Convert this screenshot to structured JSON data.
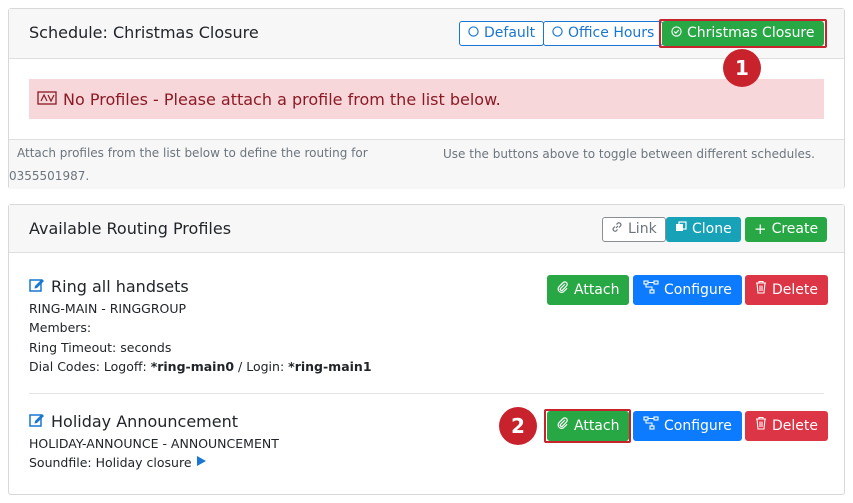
{
  "schedule": {
    "title": "Schedule: Christmas Closure",
    "buttons": {
      "default": "Default",
      "office_hours": "Office Hours",
      "christmas_closure": "Christmas Closure"
    },
    "alert": "No Profiles - Please attach a profile from the list below.",
    "footer_left_1": "Attach profiles from the list below to define the routing for",
    "footer_left_2": "0355501987.",
    "footer_right": "Use the buttons above to toggle between different schedules."
  },
  "routing": {
    "title": "Available Routing Profiles",
    "link_label": "Link",
    "clone_label": "Clone",
    "create_label": "Create",
    "profiles": [
      {
        "name": "Ring all handsets",
        "type_line": "RING-MAIN - RINGGROUP",
        "members": "Members:",
        "timeout": "Ring Timeout: seconds",
        "dial_prefix": "Dial Codes: Logoff:",
        "logoff_code": "*ring-main0",
        "login_sep": "/ Login:",
        "login_code": "*ring-main1"
      },
      {
        "name": "Holiday Announcement",
        "type_line": "HOLIDAY-ANNOUNCE - ANNOUNCEMENT",
        "soundfile": "Soundfile: Holiday closure"
      }
    ],
    "attach_label": "Attach",
    "configure_label": "Configure",
    "delete_label": "Delete"
  },
  "markers": {
    "one": "1",
    "two": "2"
  },
  "colors": {
    "highlight": "#c8232c",
    "green": "#28a745",
    "blue": "#0d7bff",
    "red": "#dc3545",
    "teal": "#17a2b8"
  }
}
